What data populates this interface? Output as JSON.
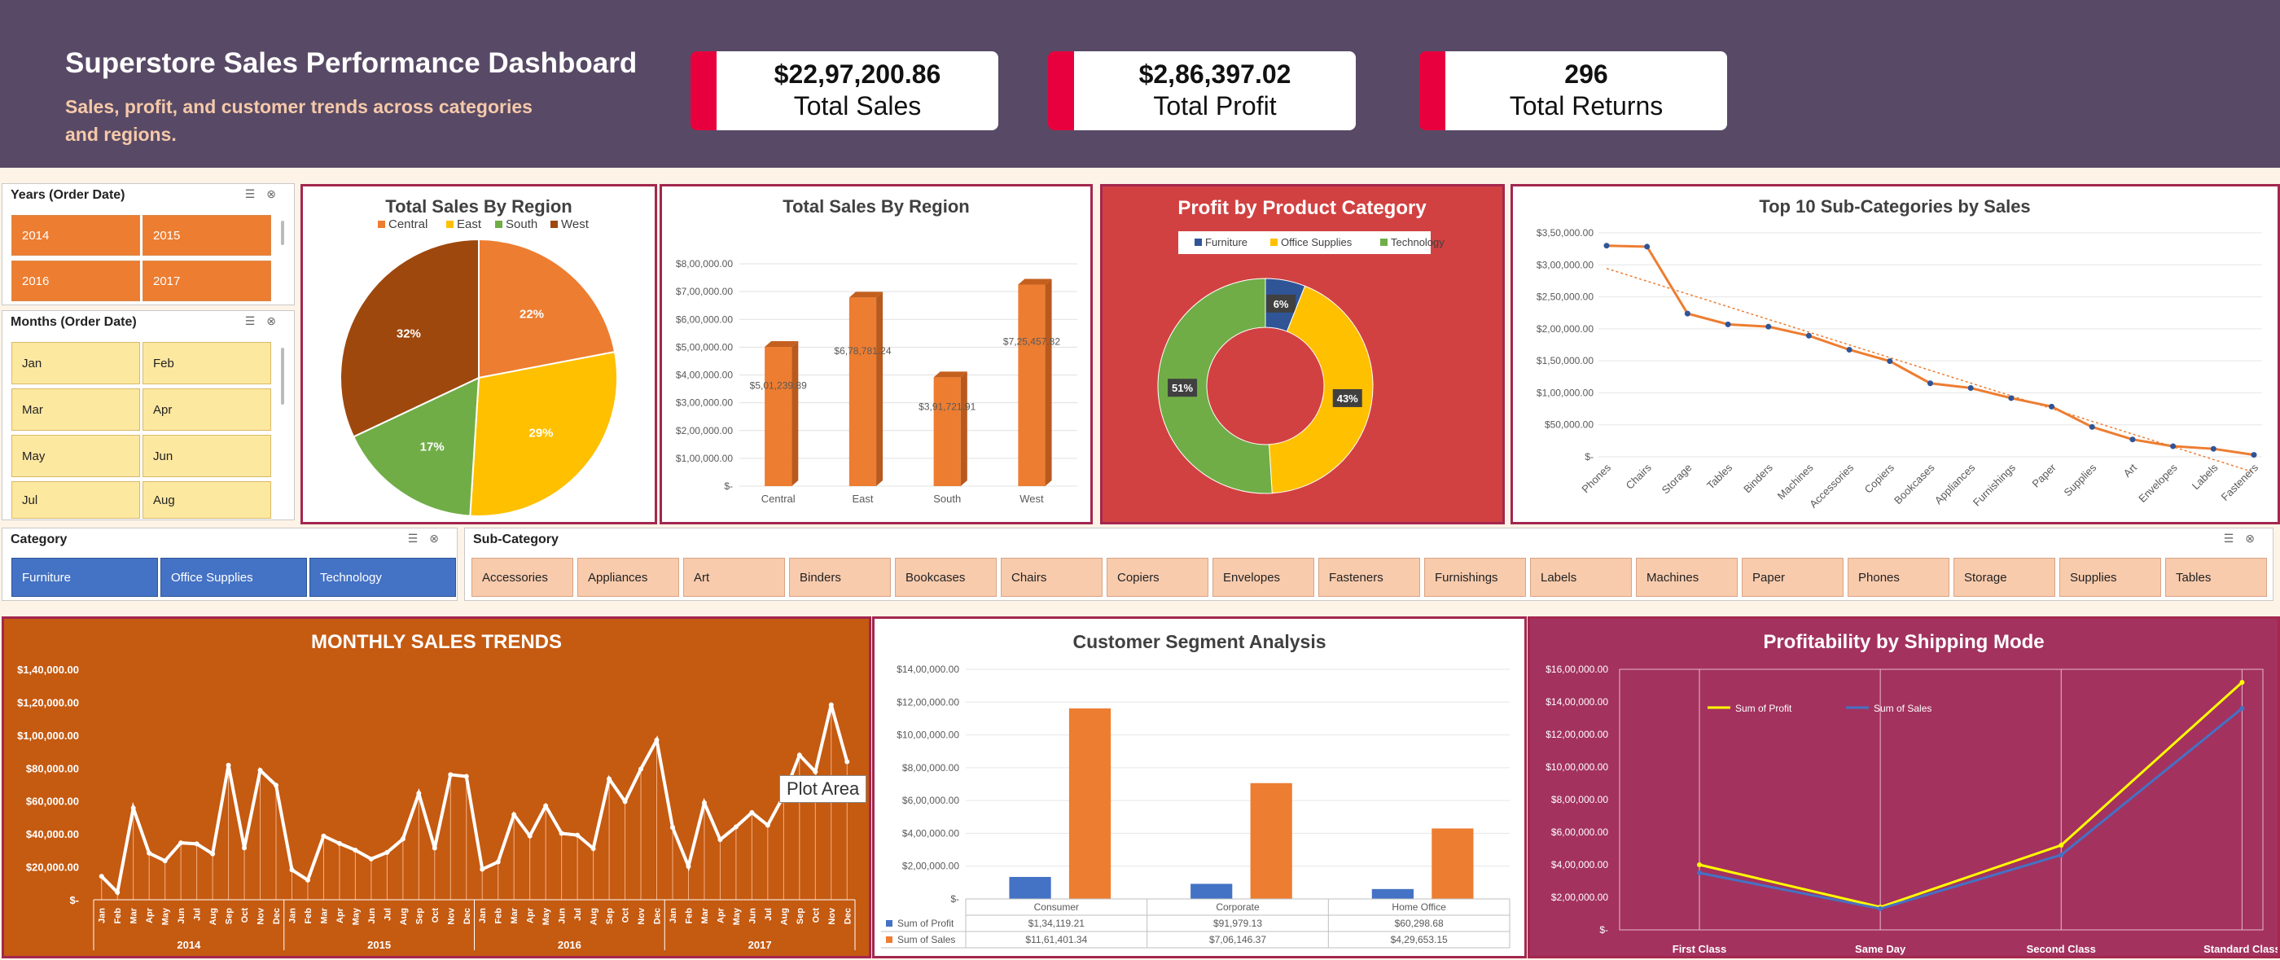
{
  "header": {
    "title": "Superstore Sales Performance Dashboard",
    "subtitle": "Sales, profit, and customer trends across categories and regions."
  },
  "kpis": [
    {
      "value": "$22,97,200.86",
      "label": "Total Sales"
    },
    {
      "value": "$2,86,397.02",
      "label": "Total Profit"
    },
    {
      "value": "296",
      "label": "Total Returns"
    }
  ],
  "slicers": {
    "years": {
      "title": "Years (Order Date)",
      "items": [
        "2014",
        "2015",
        "2016",
        "2017"
      ]
    },
    "months": {
      "title": "Months (Order Date)",
      "items": [
        "Jan",
        "Feb",
        "Mar",
        "Apr",
        "May",
        "Jun",
        "Jul",
        "Aug"
      ]
    },
    "category": {
      "title": "Category",
      "items": [
        "Furniture",
        "Office Supplies",
        "Technology"
      ]
    },
    "subcategory": {
      "title": "Sub-Category",
      "items": [
        "Accessories",
        "Appliances",
        "Art",
        "Binders",
        "Bookcases",
        "Chairs",
        "Copiers",
        "Envelopes",
        "Fasteners",
        "Furnishings",
        "Labels",
        "Machines",
        "Paper",
        "Phones",
        "Storage",
        "Supplies",
        "Tables"
      ]
    },
    "icons": [
      "multi-select-icon",
      "clear-filter-icon"
    ]
  },
  "tooltip": "Plot Area",
  "colors": {
    "header_bg": "#584a66",
    "accent": "#e8003e",
    "orange": "#ed7d31",
    "blue": "#4472c4",
    "yellow": "#ffc000",
    "green": "#70ad47",
    "brown": "#9e480e"
  },
  "chart_data": [
    {
      "type": "pie",
      "title": "Total Sales By Region",
      "categories": [
        "Central",
        "East",
        "South",
        "West"
      ],
      "values": [
        22,
        29,
        17,
        32
      ],
      "labels": [
        "22%",
        "29%",
        "17%",
        "32%"
      ],
      "colors": [
        "#ed7d31",
        "#ffc000",
        "#70ad47",
        "#9e480e"
      ],
      "legend": "top"
    },
    {
      "type": "bar",
      "title": "Total Sales By Region",
      "categories": [
        "Central",
        "East",
        "South",
        "West"
      ],
      "values": [
        501239.89,
        678781.24,
        391721.91,
        725457.82
      ],
      "data_labels": [
        "$5,01,239.89",
        "$6,78,781.24",
        "$3,91,721.91",
        "$7,25,457.82"
      ],
      "yticks": [
        "$-",
        "$1,00,000.00",
        "$2,00,000.00",
        "$3,00,000.00",
        "$4,00,000.00",
        "$5,00,000.00",
        "$6,00,000.00",
        "$7,00,000.00",
        "$8,00,000.00"
      ],
      "ylim": [
        0,
        800000
      ]
    },
    {
      "type": "pie",
      "title": "Profit by Product Category",
      "categories": [
        "Furniture",
        "Office Supplies",
        "Technology"
      ],
      "values": [
        6,
        43,
        51
      ],
      "labels": [
        "6%",
        "43%",
        "51%"
      ],
      "colors": [
        "#2f5597",
        "#ffc000",
        "#70ad47"
      ],
      "legend": "top"
    },
    {
      "type": "line",
      "title": "Top 10 Sub-Categories by Sales",
      "categories": [
        "Phones",
        "Chairs",
        "Storage",
        "Tables",
        "Binders",
        "Machines",
        "Accessories",
        "Copiers",
        "Bookcases",
        "Appliances",
        "Furnishings",
        "Paper",
        "Supplies",
        "Art",
        "Envelopes",
        "Labels",
        "Fasteners"
      ],
      "values": [
        330007,
        328449,
        223844,
        206966,
        203413,
        189239,
        167380,
        149528,
        114880,
        107532,
        91705,
        78479,
        46674,
        27119,
        16476,
        12486,
        3024
      ],
      "yticks": [
        "$-",
        "$50,000.00",
        "$1,00,000.00",
        "$1,50,000.00",
        "$2,00,000.00",
        "$2,50,000.00",
        "$3,00,000.00",
        "$3,50,000.00"
      ],
      "ylim": [
        0,
        350000
      ],
      "trendline": true
    },
    {
      "type": "line",
      "title": "MONTHLY SALES TRENDS",
      "months": [
        "Jan",
        "Feb",
        "Mar",
        "Apr",
        "May",
        "Jun",
        "Jul",
        "Aug",
        "Sep",
        "Oct",
        "Nov",
        "Dec"
      ],
      "years": [
        "2014",
        "2015",
        "2016",
        "2017"
      ],
      "values": [
        14237,
        4520,
        55691,
        28295,
        23648,
        34595,
        33946,
        27909,
        81777,
        31453,
        78629,
        69546,
        18174,
        11951,
        38726,
        34195,
        30132,
        24797,
        28765,
        36898,
        64595,
        31405,
        75972,
        74920,
        18542,
        22979,
        51716,
        38750,
        56988,
        40345,
        39262,
        31115,
        73410,
        59688,
        79412,
        96999,
        43971,
        20301,
        58872,
        36522,
        44261,
        52982,
        45264,
        63121,
        87867,
        77777,
        118448,
        83829
      ],
      "yticks": [
        "$-",
        "$20,000.00",
        "$40,000.00",
        "$60,000.00",
        "$80,000.00",
        "$1,00,000.00",
        "$1,20,000.00",
        "$1,40,000.00"
      ],
      "ylim": [
        0,
        140000
      ]
    },
    {
      "type": "bar",
      "title": "Customer Segment Analysis",
      "categories": [
        "Consumer",
        "Corporate",
        "Home Office"
      ],
      "series": [
        {
          "name": "Sum of Profit",
          "values": [
            134119.21,
            91979.13,
            60298.68
          ],
          "table": [
            "$1,34,119.21",
            "$91,979.13",
            "$60,298.68"
          ],
          "color": "#4472c4"
        },
        {
          "name": "Sum of Sales",
          "values": [
            1161401.34,
            706146.37,
            429653.15
          ],
          "table": [
            "$11,61,401.34",
            "$7,06,146.37",
            "$4,29,653.15"
          ],
          "color": "#ed7d31"
        }
      ],
      "yticks": [
        "$-",
        "$2,00,000.00",
        "$4,00,000.00",
        "$6,00,000.00",
        "$8,00,000.00",
        "$10,00,000.00",
        "$12,00,000.00",
        "$14,00,000.00"
      ],
      "ylim": [
        0,
        1400000
      ]
    },
    {
      "type": "line",
      "title": "Profitability by Shipping Mode",
      "categories": [
        "First Class",
        "Same Day",
        "Second Class",
        "Standard Class"
      ],
      "series": [
        {
          "name": "Sum of Profit",
          "values": [
            400000,
            140000,
            520000,
            1520000
          ],
          "color": "#ffff00"
        },
        {
          "name": "Sum of Sales",
          "values": [
            350000,
            130000,
            460000,
            1360000
          ],
          "color": "#4472c4"
        }
      ],
      "yticks": [
        "$-",
        "$2,00,000.00",
        "$4,00,000.00",
        "$6,00,000.00",
        "$8,00,000.00",
        "$10,00,000.00",
        "$12,00,000.00",
        "$14,00,000.00",
        "$16,00,000.00"
      ],
      "ylim": [
        0,
        1600000
      ]
    }
  ]
}
